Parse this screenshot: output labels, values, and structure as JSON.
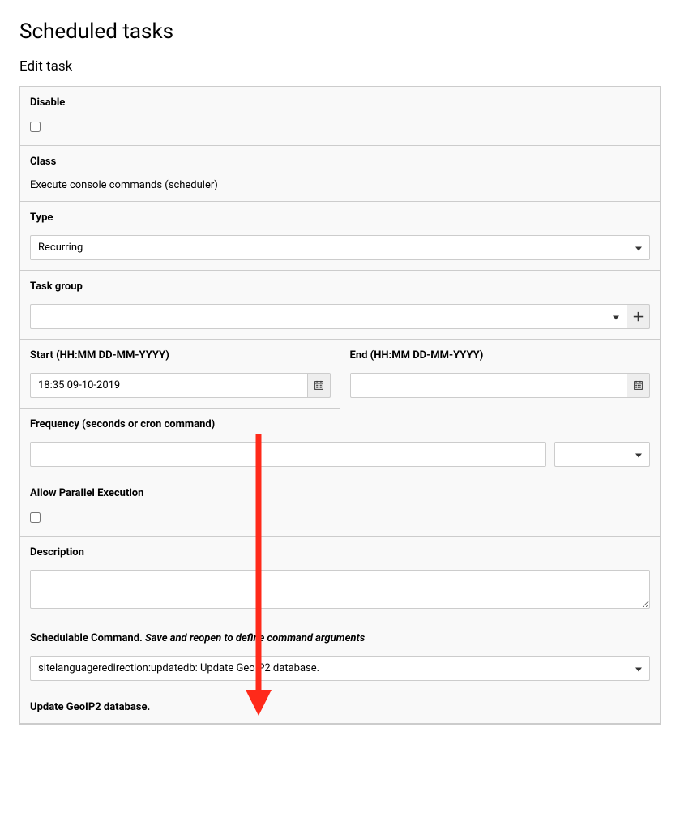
{
  "page_title": "Scheduled tasks",
  "subtitle": "Edit task",
  "labels": {
    "disable": "Disable",
    "class": "Class",
    "type": "Type",
    "task_group": "Task group",
    "start": "Start (HH:MM DD-MM-YYYY)",
    "end": "End (HH:MM DD-MM-YYYY)",
    "frequency": "Frequency (seconds or cron command)",
    "allow_parallel": "Allow Parallel Execution",
    "description": "Description",
    "schedulable_command_prefix": "Schedulable Command. ",
    "schedulable_command_note": "Save and reopen to define command arguments",
    "update_geoip": "Update GeoIP2 database."
  },
  "values": {
    "class_text": "Execute console commands (scheduler)",
    "type": "Recurring",
    "task_group": "",
    "start": "18:35 09-10-2019",
    "end": "",
    "frequency": "",
    "freq_preset": "",
    "description": "",
    "schedulable_command": "sitelanguageredirection:updatedb: Update GeoIP2 database.",
    "disable_checked": false,
    "allow_parallel_checked": false
  }
}
